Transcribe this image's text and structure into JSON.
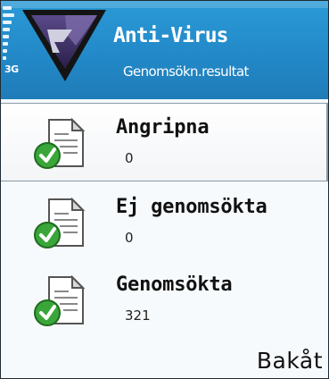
{
  "status": {
    "network": "3G"
  },
  "header": {
    "title": "Anti-Virus",
    "subtitle": "Genomsökn.resultat"
  },
  "results": [
    {
      "label": "Angripna",
      "count": "0",
      "selected": true
    },
    {
      "label": "Ej genomsökta",
      "count": "0",
      "selected": false
    },
    {
      "label": "Genomsökta",
      "count": "321",
      "selected": false
    }
  ],
  "softkeys": {
    "right": "Bakåt"
  },
  "colors": {
    "header": "#2389c8",
    "check": "#3aa63a",
    "background": "#f7fafc"
  },
  "icons": {
    "logo": "antivirus-shield-logo",
    "item": "document-check-icon"
  }
}
